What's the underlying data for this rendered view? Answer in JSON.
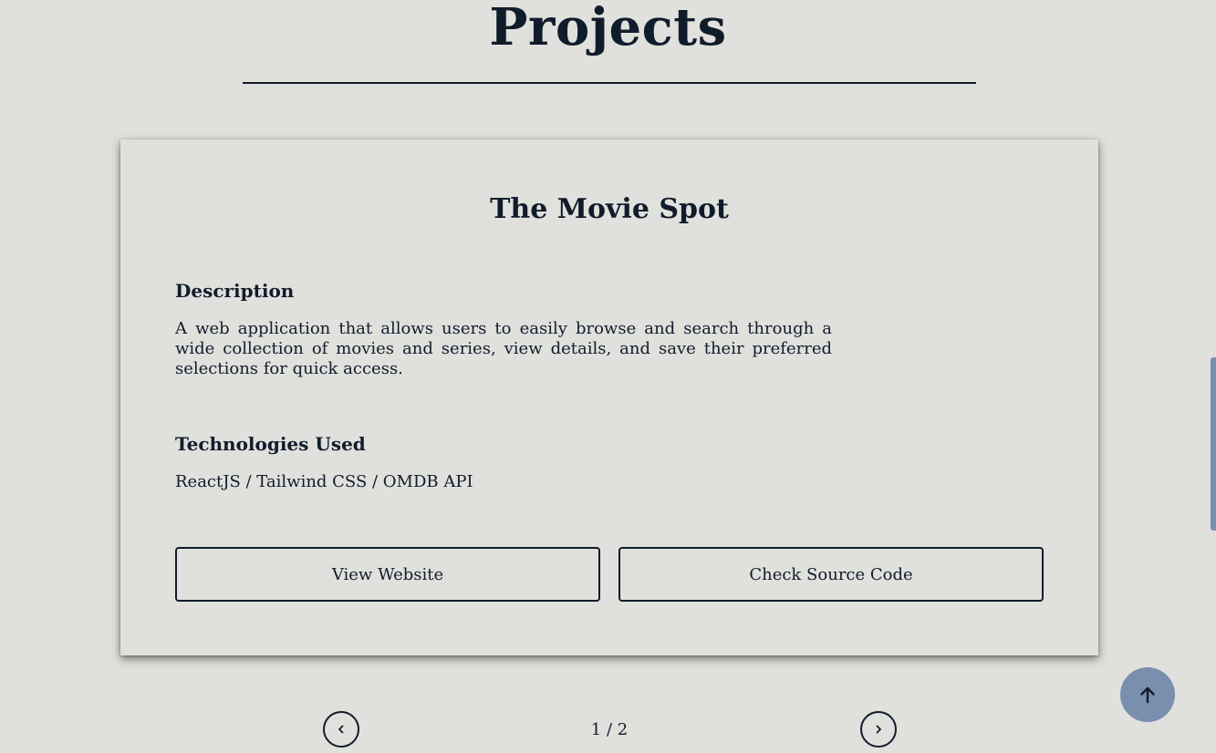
{
  "section": {
    "title": "Projects"
  },
  "project": {
    "title": "The Movie Spot",
    "description_heading": "Description",
    "description": "A web application that allows users to easily browse and search through a wide collection of movies and series, view details, and save their preferred selections for quick access.",
    "technologies_heading": "Technologies Used",
    "technologies": "ReactJS / Tailwind CSS / OMDB API",
    "view_website_label": "View Website",
    "source_code_label": "Check Source Code"
  },
  "pagination": {
    "indicator": "1 / 2",
    "prev_icon": "chevron-left-icon",
    "next_icon": "chevron-right-icon"
  },
  "scroll_to_top": {
    "icon": "arrow-up-icon",
    "color": "#7a8fae"
  },
  "colors": {
    "background": "#e0e0dd",
    "text": "#111c2b",
    "accent": "#7a8fae"
  }
}
